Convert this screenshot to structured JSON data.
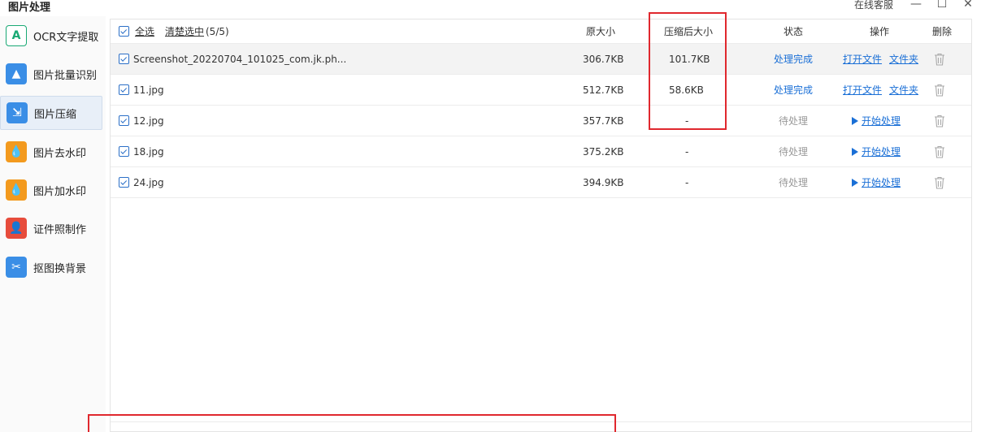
{
  "window": {
    "title": "图片处理",
    "service_label": "在线客服",
    "minimize_glyph": "—",
    "maximize_glyph": "☐",
    "close_glyph": "✕"
  },
  "sidebar": {
    "items": [
      {
        "label": "OCR文字提取",
        "icon": "ocr-icon",
        "icon_glyph": "A",
        "color": "#ffffff",
        "fg": "#19a974"
      },
      {
        "label": "图片批量识别",
        "icon": "image-batch-icon",
        "icon_glyph": "▲",
        "color": "#3a8ee6",
        "fg": "#ffffff"
      },
      {
        "label": "图片压缩",
        "icon": "compress-icon",
        "icon_glyph": "⇲",
        "color": "#3a8ee6",
        "fg": "#ffffff"
      },
      {
        "label": "图片去水印",
        "icon": "remove-watermark-icon",
        "icon_glyph": "💧",
        "color": "#f39a1e",
        "fg": "#ffffff"
      },
      {
        "label": "图片加水印",
        "icon": "add-watermark-icon",
        "icon_glyph": "💧",
        "color": "#f39a1e",
        "fg": "#ffffff"
      },
      {
        "label": "证件照制作",
        "icon": "id-photo-icon",
        "icon_glyph": "👤",
        "color": "#e74c3c",
        "fg": "#ffffff"
      },
      {
        "label": "抠图换背景",
        "icon": "cutout-icon",
        "icon_glyph": "✂",
        "color": "#3a8ee6",
        "fg": "#ffffff"
      }
    ],
    "active_index": 2
  },
  "table": {
    "select_all": "全选",
    "clear_selection": "清楚选中",
    "selection_count": "(5/5)",
    "headers": {
      "original_size": "原大小",
      "compressed_size": "压缩后大小",
      "status": "状态",
      "action": "操作",
      "delete": "删除"
    },
    "rows": [
      {
        "name": "Screenshot_20220704_101025_com.jk.ph...",
        "original": "306.7KB",
        "compressed": "101.7KB",
        "status": "处理完成",
        "status_kind": "done",
        "action1": "打开文件",
        "action2": "文件夹"
      },
      {
        "name": "11.jpg",
        "original": "512.7KB",
        "compressed": "58.6KB",
        "status": "处理完成",
        "status_kind": "done",
        "action1": "打开文件",
        "action2": "文件夹"
      },
      {
        "name": "12.jpg",
        "original": "357.7KB",
        "compressed": "-",
        "status": "待处理",
        "status_kind": "pending",
        "action1": "开始处理",
        "action2": ""
      },
      {
        "name": "18.jpg",
        "original": "375.2KB",
        "compressed": "-",
        "status": "待处理",
        "status_kind": "pending",
        "action1": "开始处理",
        "action2": ""
      },
      {
        "name": "24.jpg",
        "original": "394.9KB",
        "compressed": "-",
        "status": "待处理",
        "status_kind": "pending",
        "action1": "开始处理",
        "action2": ""
      }
    ]
  },
  "colors": {
    "accent": "#1a6fd6",
    "highlight": "#e0282e"
  }
}
